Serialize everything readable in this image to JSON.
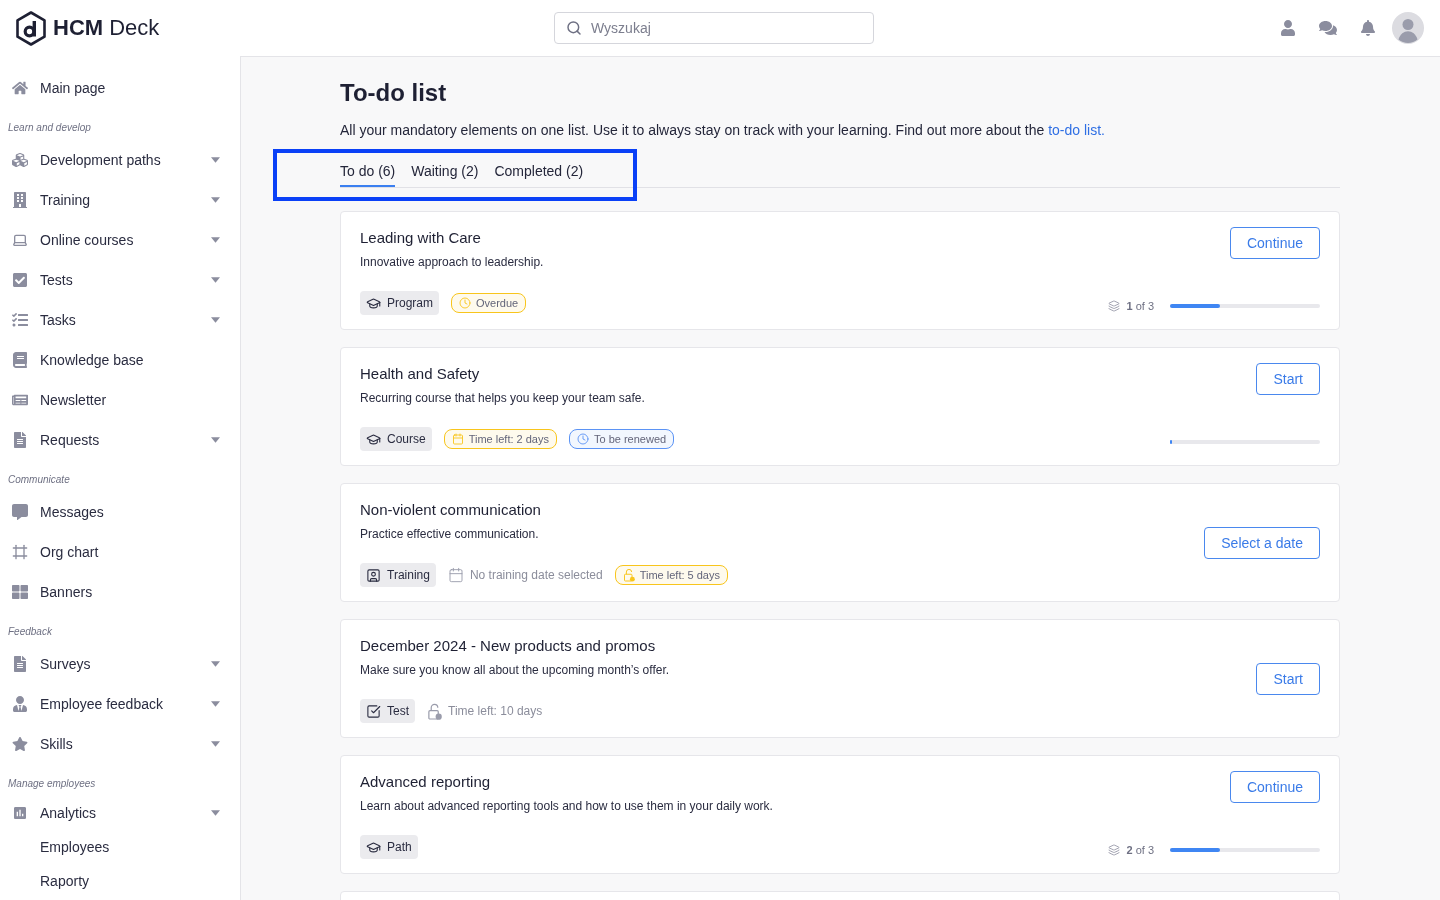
{
  "header": {
    "brand": "**HCM** Deck",
    "search": {
      "placeholder": "Wyszukaj"
    }
  },
  "sidebar": {
    "sections": [
      {
        "items": [
          {
            "label": "Main page",
            "expandable": false
          }
        ]
      },
      {
        "heading": "Learn and develop",
        "items": [
          {
            "label": "Development paths",
            "expandable": true
          },
          {
            "label": "Training",
            "expandable": true
          },
          {
            "label": "Online courses",
            "expandable": true
          },
          {
            "label": "Tests",
            "expandable": true
          },
          {
            "label": "Tasks",
            "expandable": true
          },
          {
            "label": "Knowledge base",
            "expandable": false
          },
          {
            "label": "Newsletter",
            "expandable": false
          },
          {
            "label": "Requests",
            "expandable": true
          }
        ]
      },
      {
        "heading": "Communicate",
        "items": [
          {
            "label": "Messages",
            "expandable": false
          },
          {
            "label": "Org chart",
            "expandable": false
          },
          {
            "label": "Banners",
            "expandable": false
          }
        ]
      },
      {
        "heading": "Feedback",
        "items": [
          {
            "label": "Surveys",
            "expandable": true
          },
          {
            "label": "Employee feedback",
            "expandable": true
          },
          {
            "label": "Skills",
            "expandable": true
          }
        ]
      },
      {
        "heading": "Manage employees",
        "items": [
          {
            "label": "Analytics",
            "expandable": true
          },
          {
            "label": "Employees",
            "expandable": false
          },
          {
            "label": "Raporty",
            "expandable": false
          }
        ]
      }
    ]
  },
  "page": {
    "title": "To-do list",
    "description": {
      "text": "All your mandatory elements on one list. Use it to always stay on track with your learning. Find out more about the",
      "link": "to-do list."
    },
    "tab_bar": {
      "highlighted": true,
      "tabs": [
        {
          "label": "To do (6)",
          "selected": true
        },
        {
          "label": "Waiting (2)",
          "selected": false
        },
        {
          "label": "Completed (2)",
          "selected": false
        }
      ]
    },
    "cards": [
      {
        "title": "Leading with Care",
        "description": "Innovative approach to leadership.",
        "tags": [
          {
            "kind": "program",
            "label": "Program"
          },
          {
            "kind": "overdue",
            "label": "Overdue",
            "color": "#f8c51c"
          }
        ],
        "button": "Continue",
        "progress": {
          "count": "**1** of 3",
          "level": 0.33
        }
      },
      {
        "title": "Health and Safety",
        "description": "Recurring course that helps you keep your team safe.",
        "tags": [
          {
            "kind": "course",
            "label": "Course"
          },
          {
            "kind": "deadline",
            "label": "Time left: 2 days",
            "color": "#f8c51c"
          },
          {
            "kind": "renewal",
            "label": "To be renewed",
            "color": "#5b93f5"
          }
        ],
        "button": "Start",
        "progress": {
          "level": 0
        }
      },
      {
        "title": "Non-violent communication",
        "description": "Practice effective communication.",
        "tags": [
          {
            "kind": "training",
            "label": "Training"
          },
          {
            "kind": "schedule",
            "label": "No training date selected"
          },
          {
            "kind": "limit",
            "label": "Time left: 5 days",
            "color": "#f8c51c"
          }
        ],
        "button": "Select a date"
      },
      {
        "title": "December 2024 - New products and promos",
        "description": "Make sure you know all about the upcoming month’s offer.",
        "tags": [
          {
            "kind": "test",
            "label": "Test"
          },
          {
            "kind": "limit",
            "label": "Time left: 10 days"
          }
        ],
        "button": "Start"
      },
      {
        "title": "Advanced reporting",
        "description": "Learn about advanced reporting tools and how to use them in your daily work.",
        "tags": [
          {
            "kind": "path",
            "label": "Path"
          }
        ],
        "button": "Continue",
        "progress": {
          "count": "**2** of 3",
          "level": 0.33
        }
      }
    ]
  }
}
